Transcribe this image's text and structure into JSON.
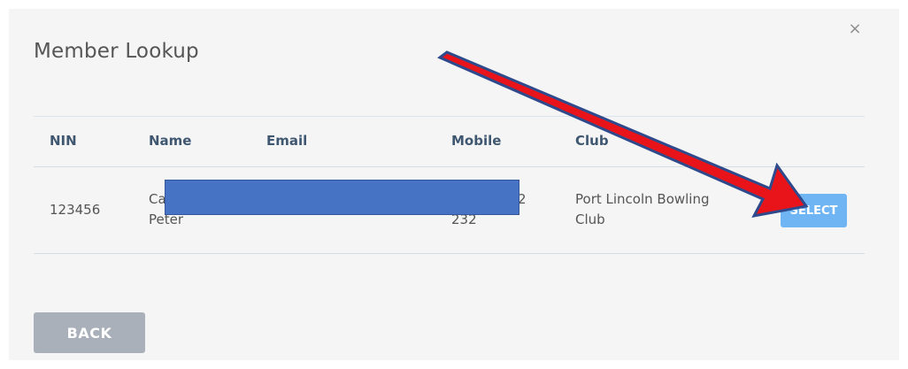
{
  "modal": {
    "title": "Member Lookup",
    "close_glyph": "×"
  },
  "table": {
    "headers": {
      "nin": "NIN",
      "name": "Name",
      "email": "Email",
      "mobile": "Mobile",
      "club": "Club"
    },
    "rows": [
      {
        "nin": "123456",
        "name_line1": "Cab",
        "name_line2": "Peter",
        "mobile_line1": "2",
        "mobile_line2": "232",
        "club_line1": "Port Lincoln Bowling",
        "club_line2": "Club",
        "action": "SELECT"
      }
    ]
  },
  "footer": {
    "back_label": "BACK"
  },
  "annotation": {
    "redaction_color": "#4673c4",
    "arrow_color": "#e8141a",
    "arrow_outline_color": "#2e4a8c"
  },
  "colors": {
    "select_button": "#6fb5f3",
    "back_button": "#a9b0b9",
    "header_text": "#3f5770"
  }
}
